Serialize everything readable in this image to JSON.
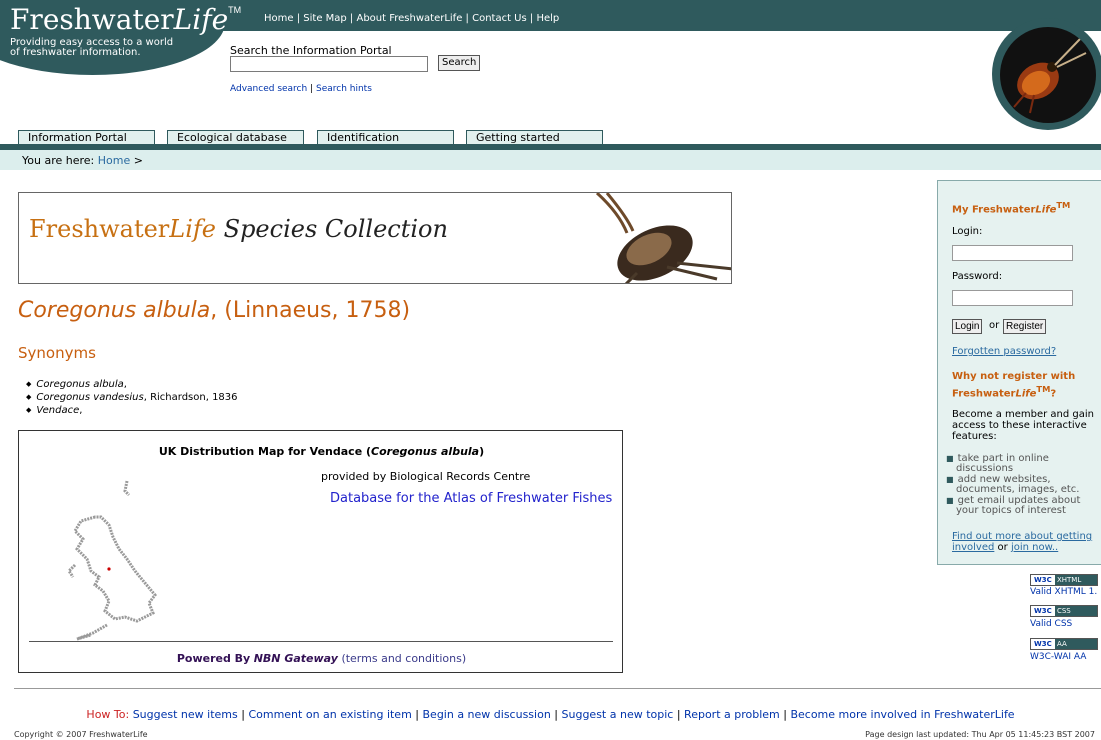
{
  "header": {
    "top_links": [
      "Home",
      "Site Map",
      "About FreshwaterLife",
      "Contact Us",
      "Help"
    ],
    "logo_main": "Freshwater",
    "logo_italic": "Life",
    "logo_tm": "TM",
    "tagline": "Providing easy access to a world of freshwater information.",
    "search_label": "Search the Information Portal",
    "search_value": "",
    "search_button": "Search",
    "advanced_search": "Advanced search",
    "search_hints": "Search hints"
  },
  "tabs": [
    "Information Portal",
    "Ecological database",
    "Identification",
    "Getting started"
  ],
  "breadcrumb": {
    "prefix": "You are here:",
    "home": "Home",
    "sep": ">"
  },
  "banner": {
    "main": "Freshwater",
    "italic": "Life",
    "rest": "Species Collection"
  },
  "species": {
    "name": "Coregonus albula",
    "author": ", (Linnaeus, 1758)"
  },
  "synonyms": {
    "heading": "Synonyms",
    "items": [
      {
        "name": "Coregonus albula",
        "rest": ","
      },
      {
        "name": "Coregonus vandesius",
        "rest": ", Richardson, 1836"
      },
      {
        "name": "Vendace",
        "rest": ","
      }
    ]
  },
  "map": {
    "title_a": "UK Distribution Map for Vendace (",
    "title_sp": "Coregonus albula",
    "title_b": ")",
    "provided": "provided by Biological Records Centre",
    "db_link": "Database for the Atlas of Freshwater Fishes",
    "powered": "Powered By",
    "gateway": "NBN Gateway",
    "terms": "(terms and conditions)"
  },
  "sidebar": {
    "title_a": "My Freshwater",
    "title_b": "Life",
    "title_tm": "TM",
    "login_label": "Login:",
    "login_value": "",
    "password_label": "Password:",
    "password_value": "",
    "login_button": "Login",
    "or": "or",
    "register_button": "Register",
    "forgot": "Forgotten password?",
    "why_a": "Why not register with Freshwater",
    "why_b": "Life",
    "why_tm": "TM",
    "why_q": "?",
    "become": "Become a member and gain access to these interactive features:",
    "features": [
      "take part in online discussions",
      "add new websites, documents, images, etc.",
      "get email updates about your topics of interest"
    ],
    "findout": "Find out more about getting involved",
    "or2": "or",
    "joinnow": "join now.."
  },
  "badges": [
    {
      "tag": "XHTML",
      "link": "Valid XHTML 1."
    },
    {
      "tag": "CSS",
      "link": "Valid CSS"
    },
    {
      "tag": "AA",
      "link": "W3C-WAI AA"
    }
  ],
  "footer": {
    "howto": "How To:",
    "links": [
      "Suggest new items",
      "Comment on an existing item",
      "Begin a new discussion",
      "Suggest a new topic",
      "Report a problem",
      "Become more involved in FreshwaterLife"
    ],
    "copyright": "Copyright © 2007 FreshwaterLife",
    "updated": "Page design last updated: Thu Apr 05 11:45:23 BST 2007"
  }
}
